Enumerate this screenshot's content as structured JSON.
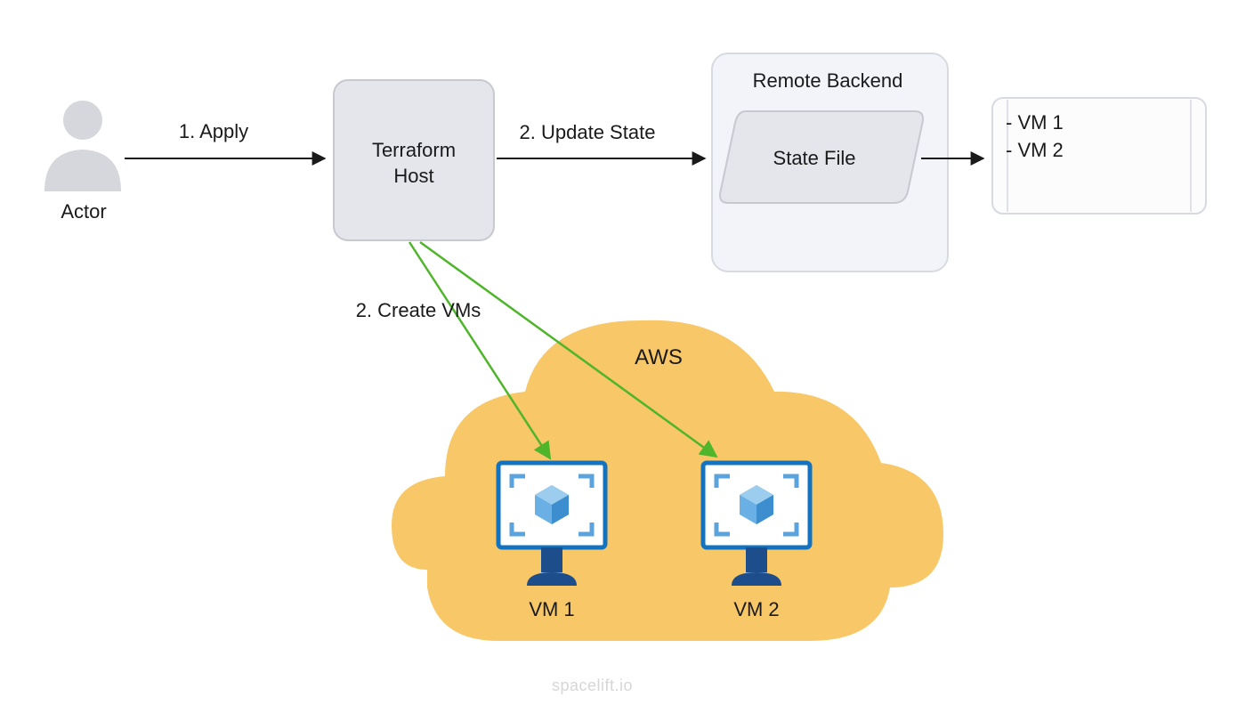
{
  "actor": {
    "label": "Actor"
  },
  "arrows": {
    "apply": "1. Apply",
    "update_state": "2. Update State",
    "create_vms": "2. Create VMs"
  },
  "terraform_host": {
    "line1": "Terraform",
    "line2": "Host"
  },
  "remote_backend": {
    "title": "Remote Backend",
    "state_file": "State File"
  },
  "vm_list": {
    "item1": "- VM 1",
    "item2": "- VM 2"
  },
  "cloud": {
    "provider": "AWS",
    "vm1": "VM 1",
    "vm2": "VM 2"
  },
  "watermark": "spacelift.io",
  "colors": {
    "box_fill": "#e5e6ec",
    "box_stroke": "#c7c8d0",
    "arrow_black": "#1a1a1a",
    "arrow_green": "#4fb52b",
    "cloud_fill": "#f7c768",
    "vm_blue": "#1473c1",
    "vm_dark": "#1e4d8b"
  }
}
